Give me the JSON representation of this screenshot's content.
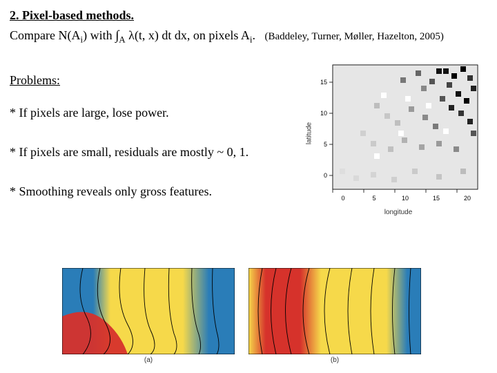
{
  "title": "2. Pixel-based methods.",
  "equation": {
    "prefix": "Compare N(A",
    "sub1": "i",
    "mid1": ") with ",
    "integral": "∫",
    "intsub": "A",
    "mid2": " λ(t, x) dt dx, on pixels A",
    "sub2": "i",
    "suffix": "."
  },
  "citation": "(Baddeley, Turner, Møller, Hazelton, 2005)",
  "problems_heading": "Problems:",
  "bullets": [
    "* If pixels are large, lose power.",
    "* If pixels are small, residuals are mostly ~ 0, 1.",
    "* Smoothing reveals only gross features."
  ],
  "raster": {
    "xlabel": "longitude",
    "ylabel": "latitude",
    "xticks": [
      "0",
      "5",
      "10",
      "15",
      "20"
    ],
    "yticks": [
      "0",
      "5",
      "10",
      "15"
    ]
  },
  "panels": {
    "a": "(a)",
    "b": "(b)"
  },
  "chart_data": [
    {
      "type": "heatmap",
      "title": "",
      "xlabel": "longitude",
      "ylabel": "latitude",
      "xlim": [
        -3,
        22
      ],
      "ylim": [
        -2,
        16
      ],
      "note": "Pixel residual grid; darker squares concentrated near top-right (high positive residuals), light/white cells scattered mid-grid, pale grey background elsewhere. Values not labeled; visual intensity only."
    },
    {
      "type": "heatmap",
      "title": "(a)",
      "note": "Smoothed residual surface with contour lines. Predominantly yellow interior with blue margins left and right, red intrusion along bottom-left. Contours roughly vertical, curving around a central high."
    },
    {
      "type": "heatmap",
      "title": "(b)",
      "note": "Smoothed residual surface with contour lines. Strong red vertical band near left edge, yellow center-right, blue at far right. Contours bowed, densest near the red/yellow transition."
    }
  ]
}
